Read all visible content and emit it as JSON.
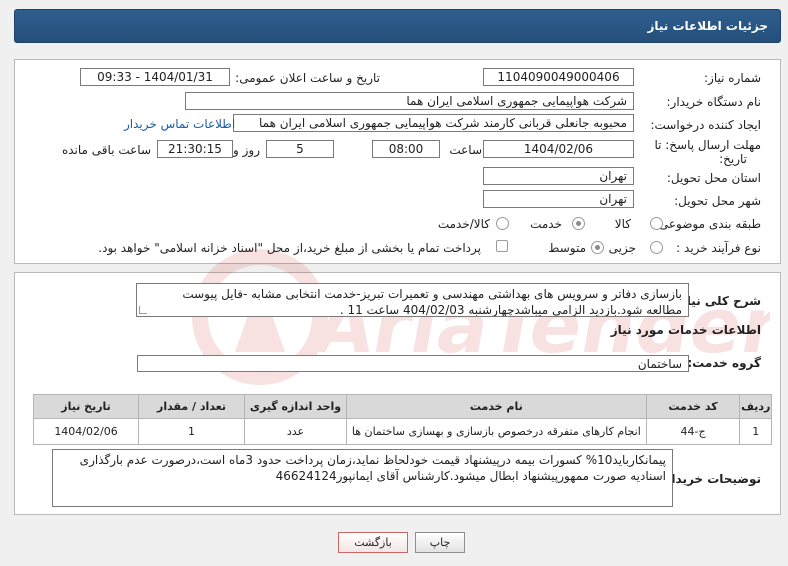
{
  "header": {
    "title": "جزئیات اطلاعات نیاز"
  },
  "form": {
    "need_number_label": "شماره نیاز:",
    "need_number": "1104090049000406",
    "announce_label": "تاریخ و ساعت اعلان عمومی:",
    "announce_value": "1404/01/31 - 09:33",
    "buyer_org_label": "نام دستگاه خریدار:",
    "buyer_org": "شرکت هواپیمایی جمهوری اسلامی ایران هما",
    "creator_label": "ایجاد کننده درخواست:",
    "creator": "محبوبه جانعلی قربانی کارمند شرکت هواپیمایی جمهوری اسلامی ایران هما",
    "contact_link": "اطلاعات تماس خریدار",
    "deadline_label": "مهلت ارسال پاسخ: تا",
    "deadline_label2": "تاریخ:",
    "deadline_date": "1404/02/06",
    "time_label": "ساعت",
    "deadline_time": "08:00",
    "days_value": "5",
    "days_label": "روز و",
    "remaining_time": "21:30:15",
    "remaining_label": "ساعت باقی مانده",
    "province_label": "استان محل تحویل:",
    "province": "تهران",
    "city_label": "شهر محل تحویل:",
    "city": "تهران",
    "category_label": "طبقه بندی موضوعی:",
    "category_options": [
      "کالا",
      "خدمت",
      "کالا/خدمت"
    ],
    "category_selected": "خدمت",
    "purchase_type_label": "نوع فرآیند خرید :",
    "purchase_options": [
      "جزیی",
      "متوسط"
    ],
    "purchase_selected": "متوسط",
    "treasury_text": "پرداخت تمام یا بخشی از مبلغ خرید،از محل \"اسناد خزانه اسلامی\" خواهد بود."
  },
  "description": {
    "label": "شرح کلی نیاز:",
    "text": "بازسازی دفاتر و سرویس های بهداشتی مهندسی و تعمیرات تبریز-خدمت انتخابی مشابه -فایل پیوست مطالعه شود.بازدید الزامی میباشدچهارشنبه 404/02/03 ساعت 11 ."
  },
  "services": {
    "section_title": "اطلاعات خدمات مورد نیاز",
    "group_label": "گروه خدمت:",
    "group_value": "ساختمان",
    "columns": [
      "ردیف",
      "کد خدمت",
      "نام خدمت",
      "واحد اندازه گیری",
      "تعداد / مقدار",
      "تاریخ نیاز"
    ],
    "rows": [
      [
        "1",
        "ج-44",
        "انجام کارهای متفرقه درخصوص بازسازی و بهسازی ساختمان ها",
        "عدد",
        "1",
        "1404/02/06"
      ]
    ]
  },
  "buyer_notes": {
    "label": "توضیحات خریدار:",
    "text": "پیمانکارباید10% کسورات بیمه درپیشنهاد قیمت خودلحاظ نماید،زمان پرداخت حدود 3ماه است،درصورت عدم بارگذاری اسنادیه صورت ممهورپیشنهاد ابطال میشود.کارشناس آقای ایمانپور46624124"
  },
  "actions": {
    "print": "چاپ",
    "back": "بازگشت"
  },
  "watermark": {
    "text": "AriaTender.neT"
  }
}
